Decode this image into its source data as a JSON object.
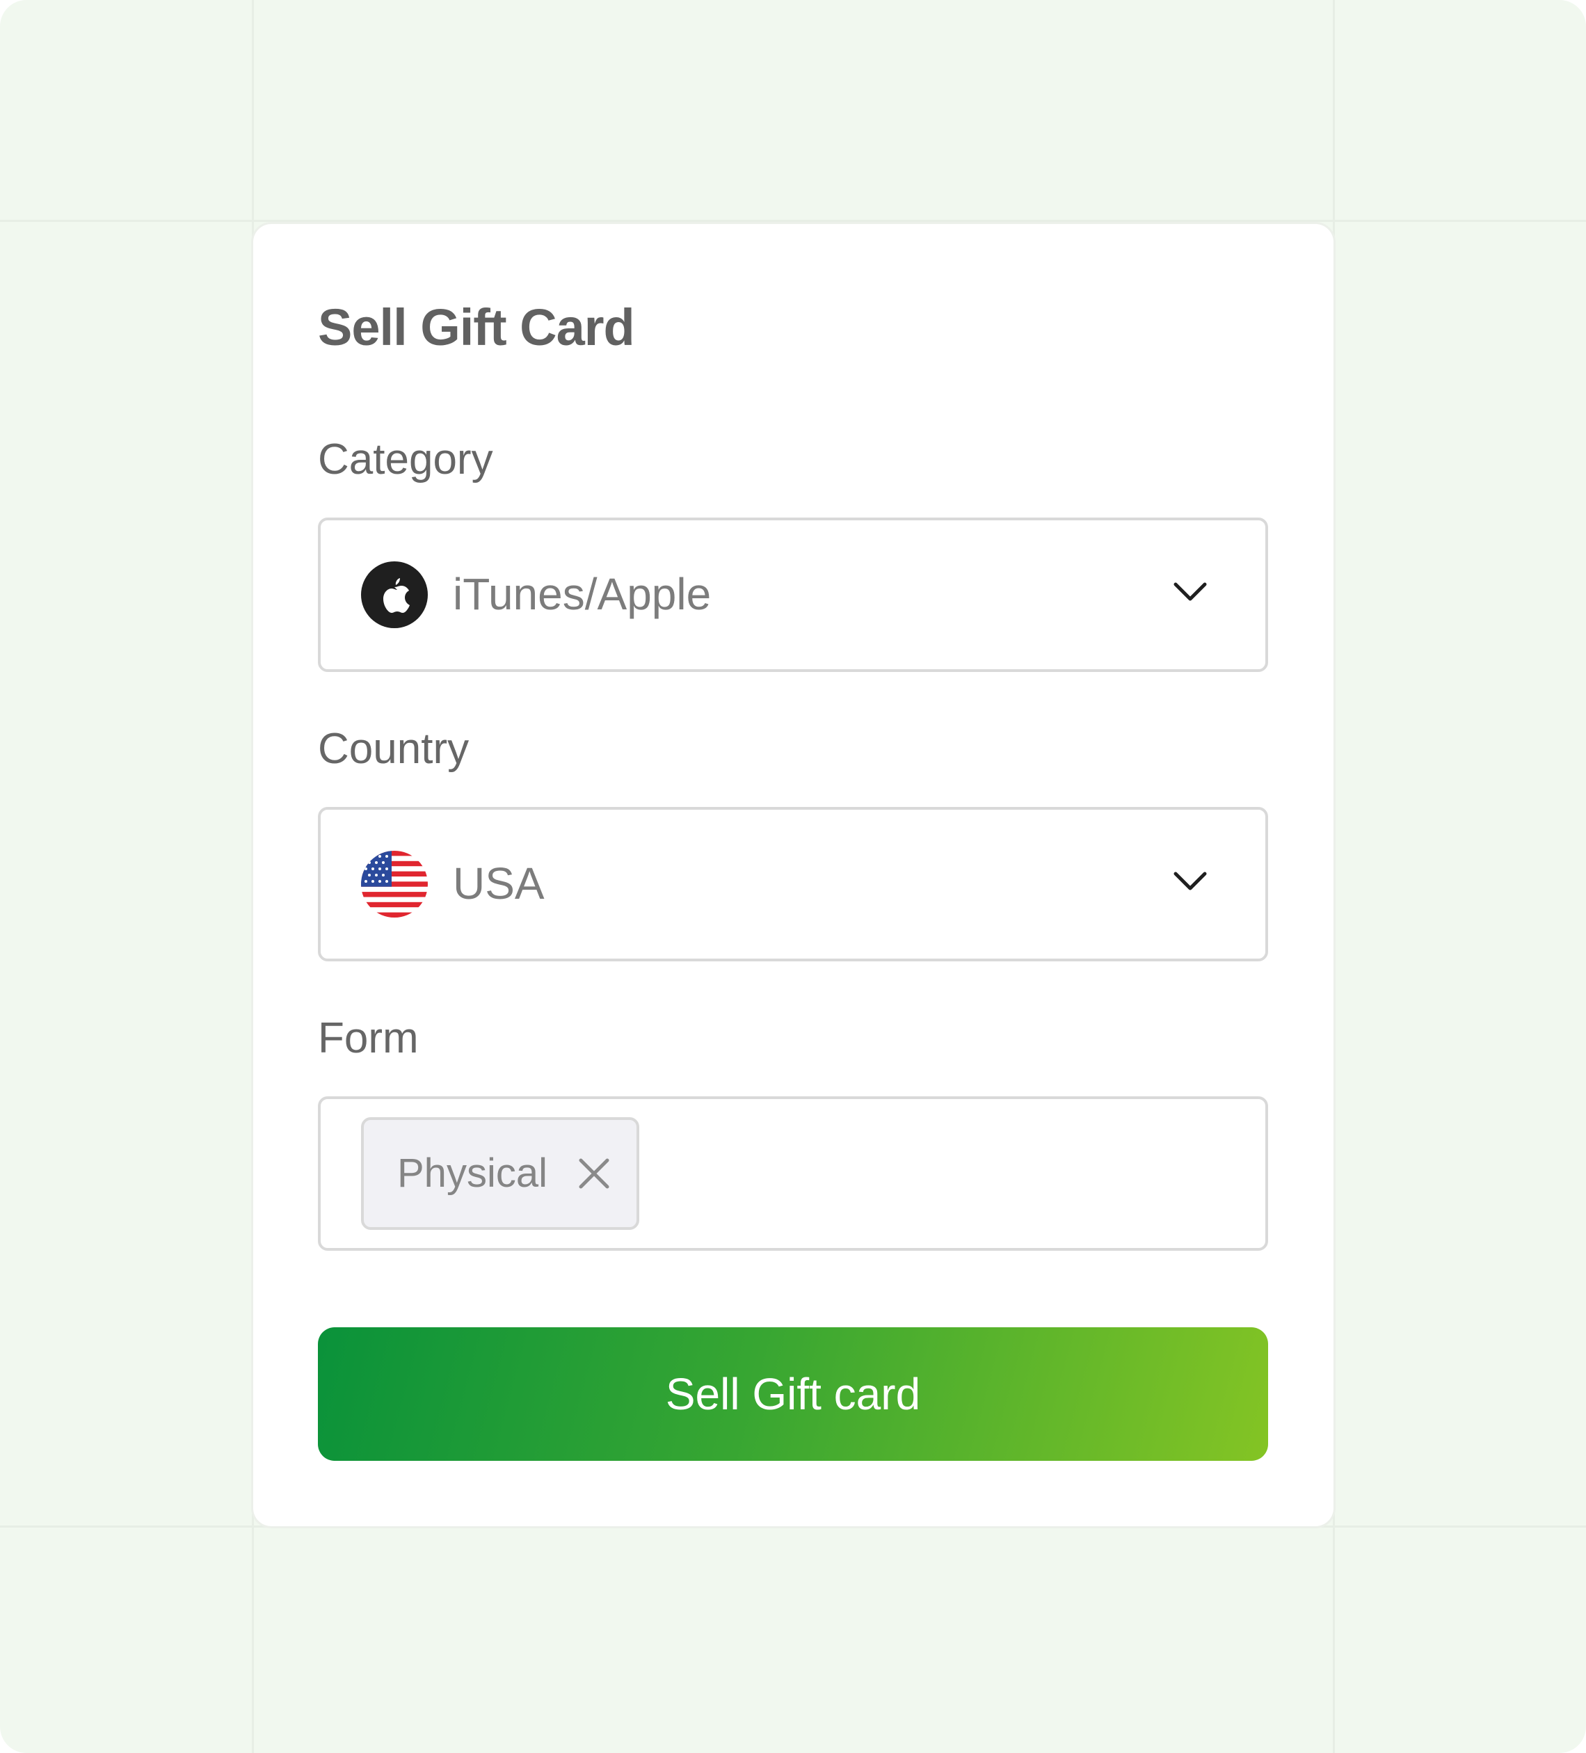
{
  "form": {
    "title": "Sell Gift Card",
    "category": {
      "label": "Category",
      "value": "iTunes/Apple",
      "icon": "apple-logo-icon"
    },
    "country": {
      "label": "Country",
      "value": "USA",
      "icon": "usa-flag-icon"
    },
    "form_type": {
      "label": "Form",
      "chips": [
        {
          "label": "Physical",
          "remove_icon": "close-icon"
        }
      ]
    },
    "submit_label": "Sell Gift card"
  },
  "colors": {
    "background": "#f1f8ef",
    "card": "#ffffff",
    "button_gradient_start": "#0a923a",
    "button_gradient_end": "#84c424",
    "title_text": "#616161",
    "value_text": "#7c7c7c"
  }
}
